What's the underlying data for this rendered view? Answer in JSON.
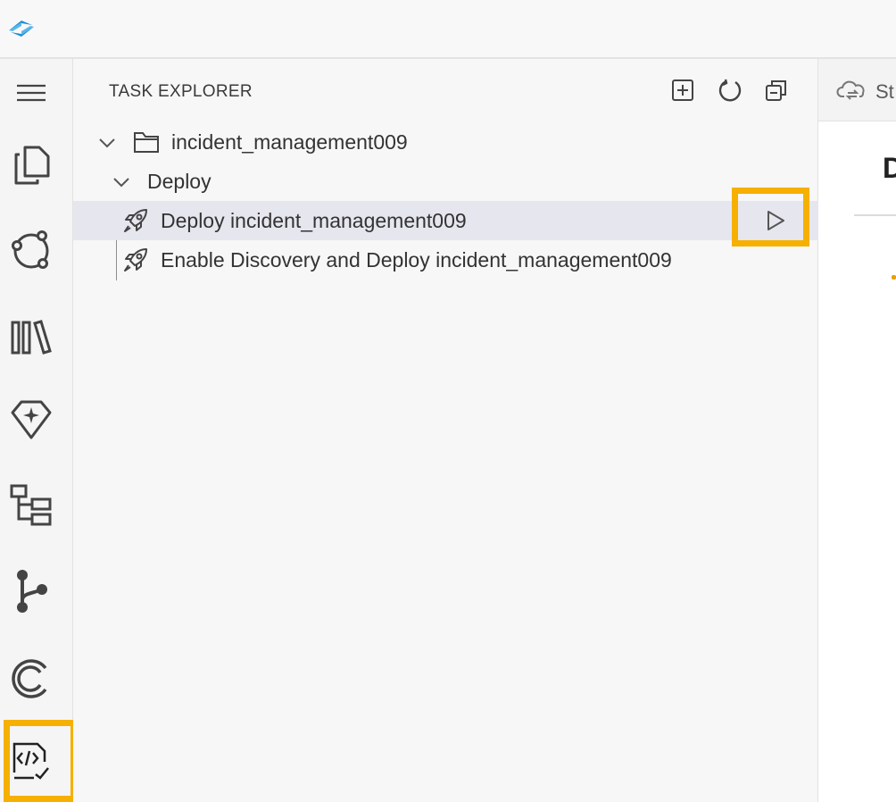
{
  "titlebar": {
    "logo_icon": "sap-bas-logo-icon"
  },
  "activity_bar": {
    "items": [
      {
        "name": "explorer",
        "icon": "files-copy-icon"
      },
      {
        "name": "storyboard",
        "icon": "cycle-nodes-icon"
      },
      {
        "name": "library",
        "icon": "books-icon"
      },
      {
        "name": "ai-assistant",
        "icon": "diamond-sparkle-icon"
      },
      {
        "name": "outline",
        "icon": "hierarchy-tree-icon"
      },
      {
        "name": "source-control",
        "icon": "git-branch-icon"
      },
      {
        "name": "remote",
        "icon": "concentric-c-icon"
      },
      {
        "name": "task-explorer",
        "icon": "code-check-icon",
        "active": true
      }
    ]
  },
  "explorer": {
    "title": "TASK EXPLORER",
    "header_actions": [
      {
        "name": "add-task",
        "icon": "plus-square-icon"
      },
      {
        "name": "refresh",
        "icon": "refresh-icon"
      },
      {
        "name": "collapse-all",
        "icon": "collapse-all-icon"
      }
    ],
    "tree": {
      "project": "incident_management009",
      "group": "Deploy",
      "tasks": [
        {
          "label": "Deploy incident_management009",
          "selected": true,
          "run_icon": "play-icon"
        },
        {
          "label": "Enable Discovery and Deploy incident_management009",
          "selected": false
        }
      ]
    }
  },
  "editor": {
    "tab_label": "St",
    "heading": "D"
  },
  "colors": {
    "highlight": "#f5b000",
    "selection": "#e6e6ef",
    "logo_blue": "#1c8fd6"
  }
}
